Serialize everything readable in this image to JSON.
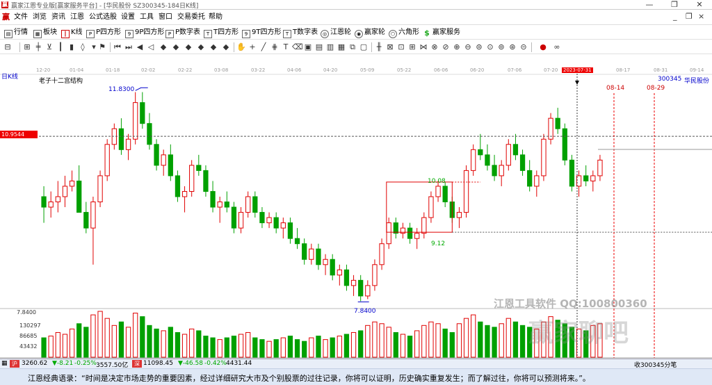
{
  "window": {
    "title": "赢家江恩专业版[赢家服务平台] - [华民股份  SZ300345-184日K线]",
    "min_icon": "minimize-icon",
    "restore_icon": "restore-icon",
    "close_icon": "close-icon"
  },
  "menu": {
    "items": [
      "文件",
      "浏览",
      "资讯",
      "江恩",
      "公式选股",
      "设置",
      "工具",
      "窗口",
      "交易委托",
      "帮助"
    ],
    "mdi_controls": [
      "_",
      "❐",
      "×"
    ]
  },
  "toolbar1": {
    "items": [
      {
        "label": "行情",
        "icon": "quote-icon"
      },
      {
        "label": "板块",
        "icon": "sector-icon"
      },
      {
        "label": "K线",
        "icon": "kline-icon"
      },
      {
        "label": "P四方形",
        "icon": "p-square-icon"
      },
      {
        "label": "9P四方形",
        "icon": "9p-square-icon"
      },
      {
        "label": "P数字表",
        "icon": "p-number-table-icon"
      },
      {
        "label": "T四方形",
        "icon": "t-square-icon"
      },
      {
        "label": "9T四方形",
        "icon": "9t-square-icon"
      },
      {
        "label": "T数字表",
        "icon": "t-number-table-icon"
      },
      {
        "label": "江恩轮",
        "icon": "gann-wheel-icon"
      },
      {
        "label": "赢家轮",
        "icon": "winner-wheel-icon"
      },
      {
        "label": "六角形",
        "icon": "hexagon-icon"
      },
      {
        "label": "赢家服务",
        "icon": "winner-service-icon"
      }
    ]
  },
  "chart": {
    "period_label": "日K线",
    "structure_label": "老子十二宫结构",
    "stock_code": "300345",
    "stock_name": "华民股份",
    "current_price_tag": "10.9544",
    "high_label": "11.8300",
    "low_label": "7.8400",
    "box_high_label": "10.08",
    "box_low_label": "9.12",
    "future_date_1": "08-14",
    "future_date_2": "08-29",
    "date_ticks": [
      "12-20",
      "01-04",
      "01-18",
      "02-02",
      "02-22",
      "03-08",
      "03-22",
      "04-06",
      "04-20",
      "05-09",
      "05-22",
      "06-06",
      "06-20",
      "07-06",
      "07-20",
      "2023-07-31",
      "08-17",
      "08-31",
      "09-14"
    ],
    "volume_axis": [
      "7.8400",
      "130297",
      "86685",
      "43432"
    ],
    "colors": {
      "up": "#e00000",
      "down": "#00a000",
      "accent": "#0000cc",
      "dash": "#555555"
    }
  },
  "chart_data": {
    "type": "candlestick",
    "title": "华民股份 SZ300345 日K线",
    "y_range": [
      7.5,
      12.1
    ],
    "ohlc": [
      [
        9.8,
        10.0,
        9.3,
        9.6
      ],
      [
        9.6,
        9.9,
        9.4,
        9.7
      ],
      [
        9.7,
        10.1,
        9.5,
        9.8
      ],
      [
        9.8,
        10.2,
        9.6,
        10.0
      ],
      [
        10.0,
        10.3,
        9.9,
        10.1
      ],
      [
        10.1,
        10.4,
        9.9,
        9.5
      ],
      [
        9.5,
        9.7,
        9.1,
        9.2
      ],
      [
        9.2,
        9.8,
        8.5,
        9.7
      ],
      [
        9.7,
        10.3,
        9.6,
        10.2
      ],
      [
        10.2,
        10.9,
        10.1,
        10.8
      ],
      [
        10.8,
        11.2,
        10.7,
        11.1
      ],
      [
        11.1,
        11.3,
        10.6,
        10.7
      ],
      [
        10.7,
        11.0,
        10.5,
        10.9
      ],
      [
        10.9,
        11.8,
        10.8,
        11.6
      ],
      [
        11.6,
        11.8,
        11.1,
        11.2
      ],
      [
        11.2,
        11.4,
        10.7,
        10.8
      ],
      [
        10.8,
        10.9,
        10.3,
        10.4
      ],
      [
        10.4,
        10.7,
        10.2,
        10.6
      ],
      [
        10.6,
        10.8,
        10.1,
        10.2
      ],
      [
        10.2,
        10.3,
        9.7,
        9.8
      ],
      [
        9.8,
        10.0,
        9.5,
        9.9
      ],
      [
        9.9,
        10.5,
        9.8,
        10.4
      ],
      [
        10.4,
        10.6,
        10.2,
        10.3
      ],
      [
        10.3,
        10.4,
        9.8,
        9.9
      ],
      [
        9.9,
        10.1,
        9.5,
        9.6
      ],
      [
        9.6,
        9.8,
        9.3,
        9.7
      ],
      [
        9.7,
        9.9,
        9.5,
        9.6
      ],
      [
        9.6,
        9.7,
        9.1,
        9.2
      ],
      [
        9.2,
        9.6,
        9.1,
        9.5
      ],
      [
        9.5,
        9.9,
        9.4,
        9.8
      ],
      [
        9.8,
        9.9,
        9.4,
        9.5
      ],
      [
        9.5,
        9.6,
        9.2,
        9.3
      ],
      [
        9.3,
        9.5,
        9.2,
        9.4
      ],
      [
        9.4,
        9.5,
        9.1,
        9.2
      ],
      [
        9.2,
        9.4,
        9.0,
        9.3
      ],
      [
        9.3,
        9.4,
        8.9,
        9.0
      ],
      [
        9.0,
        9.2,
        8.8,
        8.9
      ],
      [
        8.9,
        9.0,
        8.5,
        8.6
      ],
      [
        8.6,
        8.9,
        8.5,
        8.8
      ],
      [
        8.8,
        8.9,
        8.4,
        8.5
      ],
      [
        8.5,
        8.7,
        8.3,
        8.6
      ],
      [
        8.6,
        8.7,
        8.2,
        8.3
      ],
      [
        8.3,
        8.5,
        8.1,
        8.4
      ],
      [
        8.4,
        8.5,
        8.0,
        8.1
      ],
      [
        8.1,
        8.3,
        7.9,
        8.2
      ],
      [
        8.2,
        8.3,
        7.8,
        7.9
      ],
      [
        7.9,
        8.2,
        7.84,
        8.1
      ],
      [
        8.1,
        8.6,
        8.0,
        8.5
      ],
      [
        8.5,
        9.0,
        8.4,
        8.9
      ],
      [
        8.9,
        9.4,
        8.8,
        9.3
      ],
      [
        9.3,
        9.4,
        9.0,
        9.1
      ],
      [
        9.1,
        9.3,
        9.0,
        9.2
      ],
      [
        9.2,
        9.3,
        8.9,
        9.0
      ],
      [
        9.0,
        9.2,
        8.8,
        9.1
      ],
      [
        9.1,
        9.5,
        9.0,
        9.4
      ],
      [
        9.4,
        9.9,
        9.3,
        9.8
      ],
      [
        9.8,
        10.1,
        9.7,
        10.0
      ],
      [
        10.0,
        10.08,
        9.6,
        9.7
      ],
      [
        9.7,
        9.8,
        9.3,
        9.4
      ],
      [
        9.4,
        9.6,
        9.2,
        9.5
      ],
      [
        9.5,
        10.4,
        9.4,
        10.3
      ],
      [
        10.3,
        10.8,
        10.2,
        10.7
      ],
      [
        10.7,
        11.0,
        10.5,
        10.6
      ],
      [
        10.6,
        10.8,
        10.3,
        10.4
      ],
      [
        10.4,
        10.6,
        10.1,
        10.2
      ],
      [
        10.2,
        10.5,
        10.0,
        10.4
      ],
      [
        10.4,
        10.9,
        10.3,
        10.8
      ],
      [
        10.8,
        11.0,
        10.5,
        10.6
      ],
      [
        10.6,
        10.7,
        10.2,
        10.3
      ],
      [
        10.3,
        10.5,
        9.9,
        10.0
      ],
      [
        10.0,
        10.3,
        9.8,
        10.2
      ],
      [
        10.2,
        11.0,
        10.1,
        10.9
      ],
      [
        10.9,
        11.4,
        10.8,
        11.3
      ],
      [
        11.3,
        11.5,
        11.0,
        11.1
      ],
      [
        11.1,
        11.2,
        10.4,
        10.5
      ],
      [
        10.5,
        10.6,
        9.9,
        10.0
      ],
      [
        10.0,
        10.3,
        9.8,
        10.2
      ],
      [
        10.2,
        10.4,
        10.0,
        10.1
      ],
      [
        10.1,
        10.3,
        9.9,
        10.2
      ],
      [
        10.2,
        10.6,
        10.1,
        10.5
      ]
    ],
    "volume": [
      55,
      60,
      70,
      65,
      80,
      95,
      85,
      120,
      130,
      110,
      90,
      100,
      85,
      125,
      115,
      90,
      80,
      75,
      85,
      70,
      65,
      80,
      75,
      60,
      55,
      50,
      55,
      60,
      65,
      70,
      55,
      50,
      45,
      50,
      55,
      60,
      50,
      45,
      55,
      60,
      50,
      55,
      60,
      65,
      70,
      75,
      90,
      100,
      95,
      85,
      70,
      65,
      60,
      75,
      90,
      100,
      95,
      80,
      70,
      95,
      110,
      120,
      100,
      90,
      85,
      95,
      110,
      100,
      90,
      85,
      80,
      100,
      115,
      105,
      95,
      85,
      80,
      75,
      90,
      95
    ],
    "annotations": {
      "high": 11.83,
      "low": 7.84,
      "box_high": 10.08,
      "box_low": 9.12,
      "current": 10.9544
    }
  },
  "status": {
    "sh_index": "3260.62",
    "sh_change": "▼-8.21",
    "sh_pct": "-0.25%",
    "sh_amount": "3557.50亿",
    "sz_index": "11098.45",
    "sz_change": "▼-46.58",
    "sz_pct": "-0.42%",
    "sz_amount": "4431.44",
    "right_text": "收300345分笔"
  },
  "quote": {
    "text": "江恩经典语录：“时间是决定市场走势的重要因素，经过详细研究大市及个别股票的过往记录，你将可以证明，历史确实重复发生；而了解过往，你将可以预测将来。”。"
  },
  "watermark": {
    "line1": "江恩工具软件  QQ:100800360",
    "line2": "赢家聊吧"
  }
}
